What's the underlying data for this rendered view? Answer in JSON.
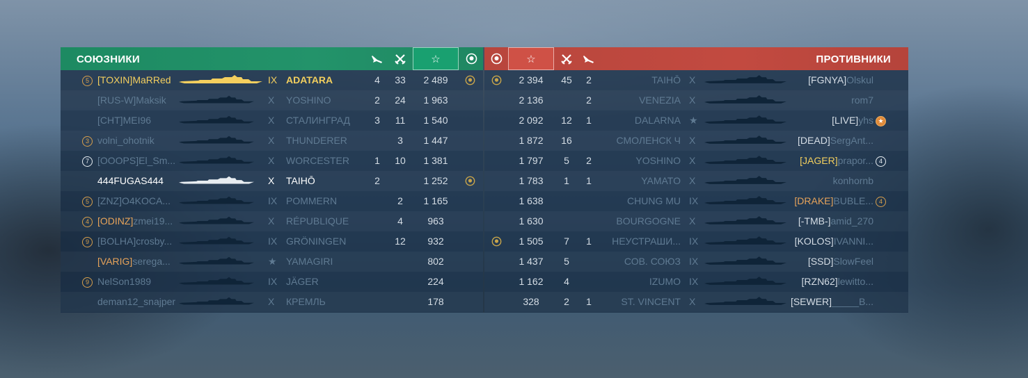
{
  "allies": {
    "title": "СОЮЗНИКИ",
    "rows": [
      {
        "badge": "5",
        "badge_style": "orange",
        "clan": "[TOXIN]",
        "name": "MaRRed",
        "tier": "IX",
        "ship": "ADATARA",
        "planes": "4",
        "kills": "33",
        "score": "2 489",
        "medal": true,
        "style": "self"
      },
      {
        "badge": "",
        "clan": "[RUS-W]",
        "name": "Maksik",
        "tier": "X",
        "ship": "YOSHINO",
        "planes": "2",
        "kills": "24",
        "score": "1 963",
        "medal": false,
        "style": "dim"
      },
      {
        "badge": "",
        "clan": "[CHT]",
        "name": "MEI96",
        "tier": "X",
        "ship": "СТАЛИНГРАД",
        "planes": "3",
        "kills": "11",
        "score": "1 540",
        "medal": false,
        "style": "dim"
      },
      {
        "badge": "3",
        "badge_style": "orange",
        "clan": "",
        "name": "volni_ohotnik",
        "tier": "X",
        "ship": "THUNDERER",
        "planes": "",
        "kills": "3",
        "score": "1 447",
        "medal": false,
        "style": "dim"
      },
      {
        "badge": "7",
        "badge_style": "white",
        "clan": "[OOOPS]",
        "name": "El_Sm...",
        "tier": "X",
        "ship": "WORCESTER",
        "planes": "1",
        "kills": "10",
        "score": "1 381",
        "medal": false,
        "style": "dim"
      },
      {
        "badge": "",
        "clan": "",
        "name": "444FUGAS444",
        "tier": "X",
        "ship": "TAIHŌ",
        "planes": "2",
        "kills": "",
        "score": "1 252",
        "medal": true,
        "style": "alive"
      },
      {
        "badge": "5",
        "badge_style": "orange",
        "clan": "[ZNZ]",
        "name": "O4KOCA...",
        "tier": "IX",
        "ship": "POMMERN",
        "planes": "",
        "kills": "2",
        "score": "1 165",
        "medal": false,
        "style": "dim"
      },
      {
        "badge": "4",
        "badge_style": "orange",
        "clan": "[ODINZ]",
        "name": "zmei19...",
        "tier": "X",
        "ship": "RÉPUBLIQUE",
        "planes": "",
        "kills": "4",
        "score": "963",
        "medal": false,
        "style": "dimorange"
      },
      {
        "badge": "9",
        "badge_style": "orange",
        "clan": "[BOLHA]",
        "name": "crosby...",
        "tier": "IX",
        "ship": "GRÖNINGEN",
        "planes": "",
        "kills": "12",
        "score": "932",
        "medal": false,
        "style": "dim"
      },
      {
        "badge": "",
        "clan": "[VARIG]",
        "name": "serega...",
        "tier": "★",
        "ship": "YAMAGIRI",
        "planes": "",
        "kills": "",
        "score": "802",
        "medal": false,
        "style": "dimorange"
      },
      {
        "badge": "9",
        "badge_style": "orange",
        "clan": "",
        "name": "NelSon1989",
        "tier": "IX",
        "ship": "JÄGER",
        "planes": "",
        "kills": "",
        "score": "224",
        "medal": false,
        "style": "dim"
      },
      {
        "badge": "",
        "clan": "",
        "name": "deman12_snajper",
        "tier": "X",
        "ship": "КРЕМЛЬ",
        "planes": "",
        "kills": "",
        "score": "178",
        "medal": false,
        "style": "dim"
      }
    ]
  },
  "enemies": {
    "title": "ПРОТИВНИКИ",
    "rows": [
      {
        "medal": true,
        "score": "2 394",
        "kills": "45",
        "planes": "2",
        "ship": "TAIHŌ",
        "tier": "X",
        "clan": "[FGNYA]",
        "name": "Olskul",
        "badge": "",
        "style": "dim"
      },
      {
        "medal": false,
        "score": "2 136",
        "kills": "",
        "planes": "2",
        "ship": "VENEZIA",
        "tier": "X",
        "clan": "",
        "name": "rom7",
        "badge": "",
        "style": "dim"
      },
      {
        "medal": false,
        "score": "2 092",
        "kills": "12",
        "planes": "1",
        "ship": "DALARNA",
        "tier": "★",
        "clan": "[LIVE]",
        "name": "yhs",
        "badge": "★",
        "badge_style": "filled",
        "style": "dim"
      },
      {
        "medal": false,
        "score": "1 872",
        "kills": "16",
        "planes": "",
        "ship": "СМОЛЕНСК Ч",
        "tier": "X",
        "clan": "[DEAD]",
        "name": "SergAnt...",
        "badge": "",
        "style": "dim"
      },
      {
        "medal": false,
        "score": "1 797",
        "kills": "5",
        "planes": "2",
        "ship": "YOSHINO",
        "tier": "X",
        "clan": "[JAGER]",
        "name": "prapor...",
        "badge": "4",
        "badge_style": "white",
        "style": "dimgold"
      },
      {
        "medal": false,
        "score": "1 783",
        "kills": "1",
        "planes": "1",
        "ship": "YAMATO",
        "tier": "X",
        "clan": "",
        "name": "konhornb",
        "badge": "",
        "style": "dim"
      },
      {
        "medal": false,
        "score": "1 638",
        "kills": "",
        "planes": "",
        "ship": "CHUNG MU",
        "tier": "IX",
        "clan": "[DRAKE]",
        "name": "BUBLE...",
        "badge": "4",
        "badge_style": "orange",
        "style": "dimorange"
      },
      {
        "medal": false,
        "score": "1 630",
        "kills": "",
        "planes": "",
        "ship": "BOURGOGNE",
        "tier": "X",
        "clan": "[-TMB-]",
        "name": "amid_270",
        "badge": "",
        "style": "dim"
      },
      {
        "medal": true,
        "score": "1 505",
        "kills": "7",
        "planes": "1",
        "ship": "НЕУСТРАШИ...",
        "tier": "IX",
        "clan": "[KOLOS]",
        "name": "IVANNI...",
        "badge": "",
        "style": "dim"
      },
      {
        "medal": false,
        "score": "1 437",
        "kills": "5",
        "planes": "",
        "ship": "СОВ. СОЮЗ",
        "tier": "IX",
        "clan": "[SSD]",
        "name": "SlowFeel",
        "badge": "",
        "style": "dim"
      },
      {
        "medal": false,
        "score": "1 162",
        "kills": "4",
        "planes": "",
        "ship": "IZUMO",
        "tier": "IX",
        "clan": "[RZN62]",
        "name": "lewitto...",
        "badge": "",
        "style": "dim"
      },
      {
        "medal": false,
        "score": "328",
        "kills": "2",
        "planes": "1",
        "ship": "ST. VINCENT",
        "tier": "X",
        "clan": "[SEWER]",
        "name": "_____B...",
        "badge": "",
        "style": "dim"
      }
    ]
  },
  "icons": {
    "planes": "plane-icon",
    "kills": "crossed-swords-icon",
    "score": "star-icon",
    "medal": "wreath-medal-icon"
  },
  "colors": {
    "allies_header": "#23936a",
    "enemies_header": "#c24a40",
    "self": "#f3cf5e",
    "division": "#e7a35a"
  }
}
